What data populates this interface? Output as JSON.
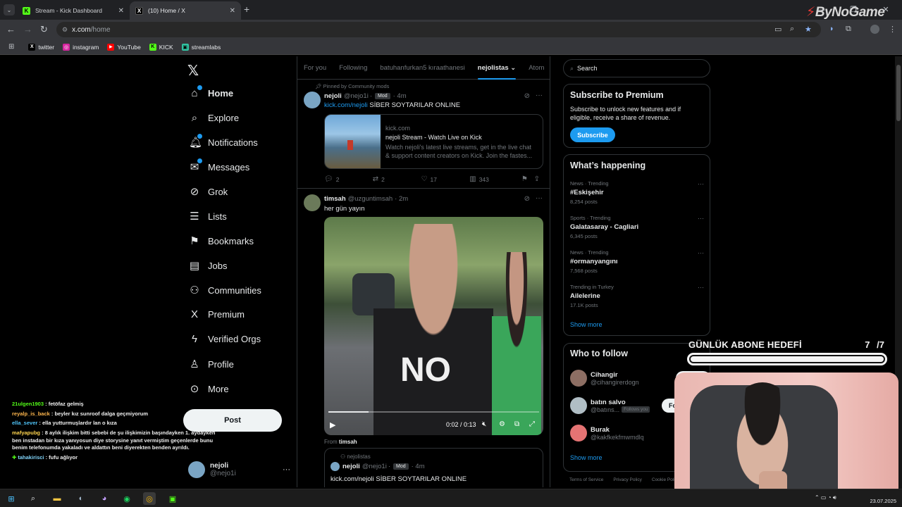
{
  "browser": {
    "tabs": [
      {
        "title": "Stream - Kick Dashboard",
        "favicon": "K",
        "color": "#53fc18"
      },
      {
        "title": "(10) Home / X",
        "favicon": "X",
        "color": "#000000"
      }
    ],
    "url_host": "x.com",
    "url_path": "/home",
    "bookmarks": [
      {
        "label": "twitter",
        "icon": "X",
        "color": "#000000"
      },
      {
        "label": "instagram",
        "icon": "◎",
        "color": "#d6249f"
      },
      {
        "label": "YouTube",
        "icon": "▶",
        "color": "#ff0000"
      },
      {
        "label": "KICK",
        "icon": "K",
        "color": "#53fc18"
      },
      {
        "label": "streamlabs",
        "icon": "▣",
        "color": "#31c3a2"
      }
    ],
    "watermark": "ByNoGame"
  },
  "sidebar": {
    "items": [
      {
        "label": "Home",
        "icon": "home-icon",
        "glyph": "⌂",
        "bold": true,
        "dot": true
      },
      {
        "label": "Explore",
        "icon": "search-icon",
        "glyph": "⌕",
        "dot": false
      },
      {
        "label": "Notifications",
        "icon": "bell-icon",
        "glyph": "🔔︎",
        "dot": true
      },
      {
        "label": "Messages",
        "icon": "envelope-icon",
        "glyph": "✉",
        "dot": true
      },
      {
        "label": "Grok",
        "icon": "grok-icon",
        "glyph": "⊘",
        "dot": false
      },
      {
        "label": "Lists",
        "icon": "list-icon",
        "glyph": "☰",
        "dot": false
      },
      {
        "label": "Bookmarks",
        "icon": "bookmark-icon",
        "glyph": "⚑",
        "dot": false
      },
      {
        "label": "Jobs",
        "icon": "briefcase-icon",
        "glyph": "▤",
        "dot": false
      },
      {
        "label": "Communities",
        "icon": "people-icon",
        "glyph": "⚇",
        "dot": false
      },
      {
        "label": "Premium",
        "icon": "x-premium-icon",
        "glyph": "X",
        "dot": false
      },
      {
        "label": "Verified Orgs",
        "icon": "lightning-icon",
        "glyph": "ϟ",
        "dot": false
      },
      {
        "label": "Profile",
        "icon": "person-icon",
        "glyph": "♙",
        "dot": false
      },
      {
        "label": "More",
        "icon": "more-circle-icon",
        "glyph": "⊙",
        "dot": false
      }
    ],
    "post_label": "Post",
    "account": {
      "name": "nejoli",
      "handle": "@nejo1i"
    }
  },
  "timeline": {
    "tabs": [
      "For you",
      "Following",
      "batuhanfurkan5 kıraathanesi",
      "nejolistas",
      "Atom"
    ],
    "selected_tab": "nejolistas",
    "pinned_label": "Pinned by Community mods",
    "tweet1": {
      "name": "nejoli",
      "handle": "@nejo1i",
      "mod_badge": "Mod",
      "time": "· 4m",
      "link": "kick.com/nejoli",
      "text": " SİBER SOYTARILAR ONLINE",
      "card": {
        "domain": "kick.com",
        "title": "nejoli Stream - Watch Live on Kick",
        "desc1": "Watch nejoli's latest live streams, get in the live chat",
        "desc2": "& support content creators on Kick. Join the fastes..."
      },
      "stats": {
        "replies": "2",
        "reposts": "2",
        "likes": "17",
        "views": "343"
      }
    },
    "tweet2": {
      "name": "timsah",
      "handle": "@uzguntimsah",
      "time": "· 2m",
      "text": "her gün yayın",
      "video": {
        "shirt_text": "NO",
        "current": "0:02",
        "duration": "0:13",
        "progress": 0.19
      },
      "from_prefix": "From ",
      "from_name": "timsah",
      "quote": {
        "community": "nejolistas",
        "name": "nejoli",
        "handle": "@nejo1i",
        "mod_badge": "Mod",
        "time": "· 4m",
        "text": "kick.com/nejoli SİBER SOYTARILAR ONLINE"
      }
    }
  },
  "right": {
    "search_placeholder": "Search",
    "premium": {
      "title": "Subscribe to Premium",
      "desc": "Subscribe to unlock new features and if eligible, receive a share of revenue.",
      "button": "Subscribe"
    },
    "happening": {
      "title": "What’s happening",
      "trends": [
        {
          "category": "News · Trending",
          "name": "#Eskişehir",
          "count": "8,254 posts"
        },
        {
          "category": "Sports · Trending",
          "name": "Galatasaray - Cagliari",
          "count": "6,345 posts"
        },
        {
          "category": "News · Trending",
          "name": "#ormanyangını",
          "count": "7,568 posts"
        },
        {
          "category": "Trending in Turkey",
          "name": "Ailelerine",
          "count": "17.1K posts"
        }
      ],
      "show_more": "Show more"
    },
    "who_to_follow": {
      "title": "Who to follow",
      "users": [
        {
          "name": "Cihangir",
          "handle": "@cihangirerdogn",
          "follows_you": "",
          "avatar_color": "#8d6e63"
        },
        {
          "name": "batın salvo",
          "handle": "@batıns...",
          "follows_you": "Follows you",
          "avatar_color": "#b0bec5"
        },
        {
          "name": "Burak",
          "handle": "@kakfkekfmwmdlq",
          "follows_you": "",
          "avatar_color": "#e57373"
        }
      ],
      "follow_label": "Follow",
      "show_more": "Show more"
    },
    "footer": [
      "Terms of Service",
      "Privacy Policy",
      "Cookie Policy"
    ]
  },
  "overlay": {
    "chat": [
      {
        "user": "21ulgen1903",
        "text": "fetöfaz gelmiş",
        "color": "#53fc18"
      },
      {
        "user": "reyalp_is_back",
        "text": "beyler kız sunroof dalga geçmiyorum",
        "color": "#ffb74d"
      },
      {
        "user": "ella_sever",
        "text": "ella yutturmuşlardır lan o kıza",
        "color": "#4fc3f7"
      },
      {
        "user": "mafyapubg",
        "text": "8 aylık ilişkim bitti sebebi de şu ilişkimizin başındayken 1. aydayken ben instadan bir kıza yanıyosun diye storysine yanıt vermiştim geçenlerde bunu benim telefonumda yakaladı ve aldattın beni diyerekten benden ayrıldı.",
        "color": "#ffd54f"
      },
      {
        "user": "tahakirisci",
        "text": "fufu ağlıyor",
        "color": "#81d4fa",
        "badge": "✚"
      }
    ],
    "goal_label": "GÜNLÜK ABONE HEDEFİ",
    "goal_current": "7",
    "goal_separator": "/",
    "goal_target": "7",
    "goal_progress": 1.0
  },
  "taskbar": {
    "time": "",
    "date": "23.07.2025"
  }
}
